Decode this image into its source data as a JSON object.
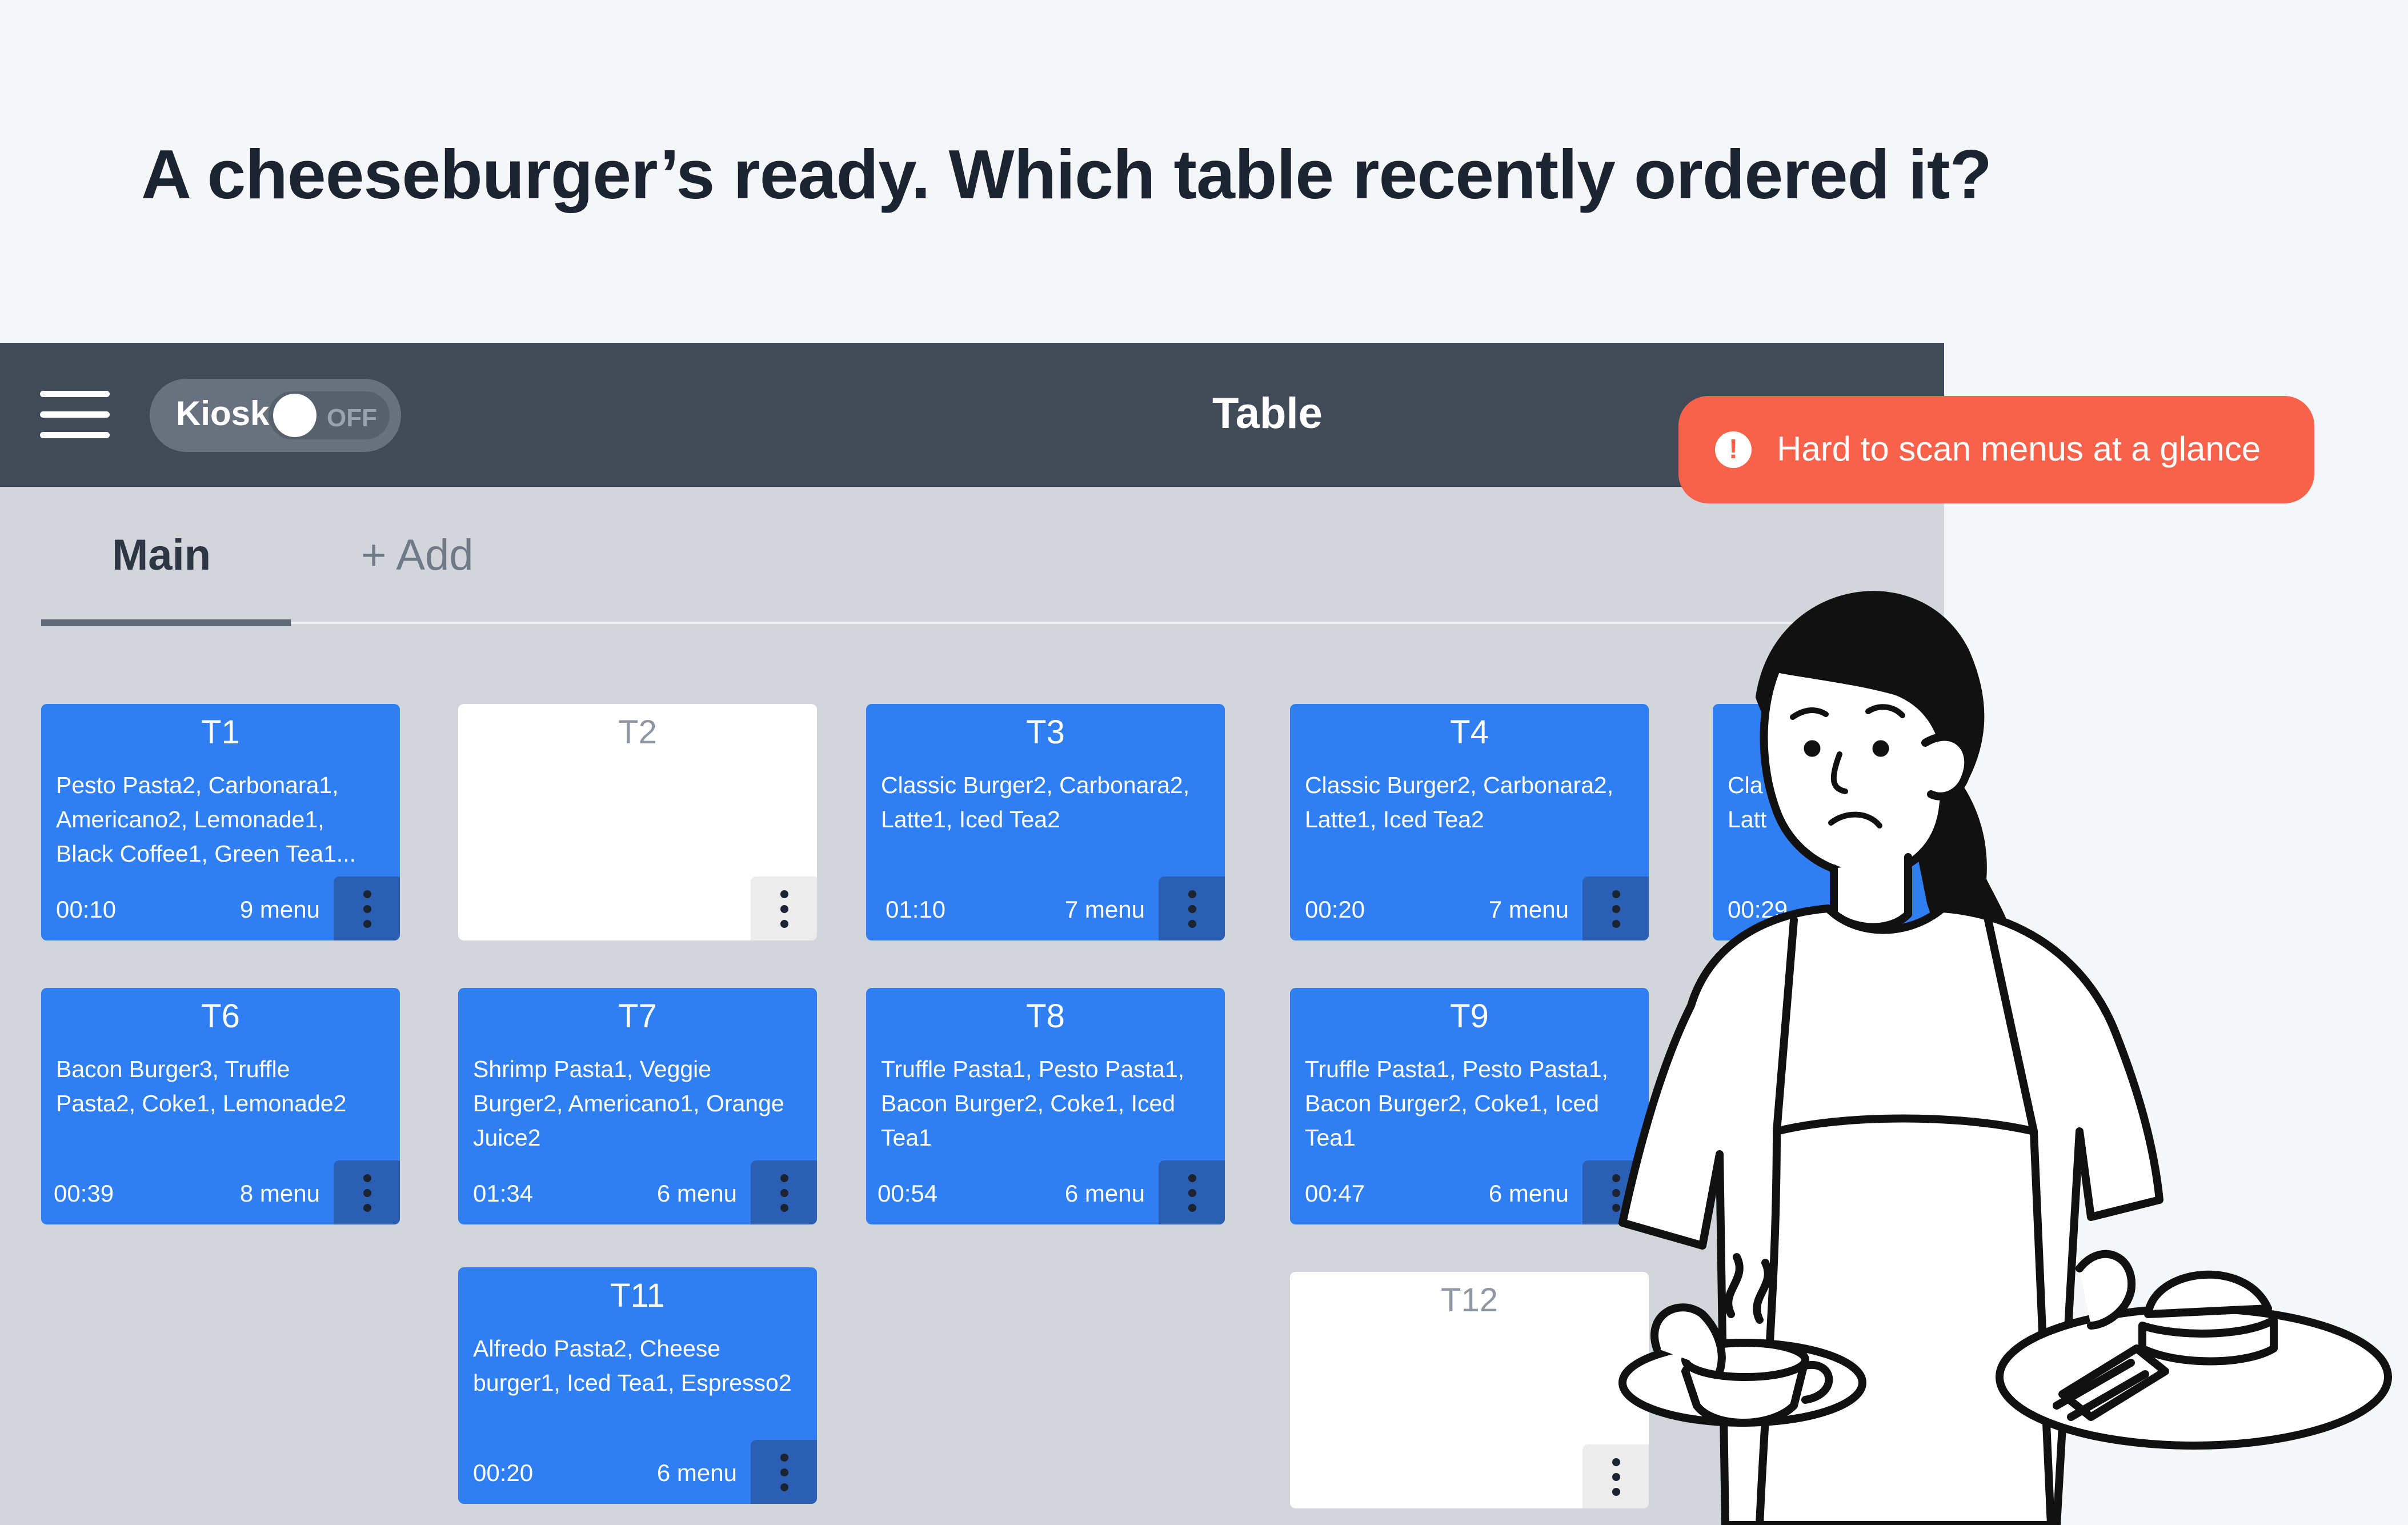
{
  "headline": "A cheeseburger’s ready. Which table recently ordered it?",
  "topbar": {
    "title": "Table",
    "kiosk": {
      "label": "Kiosk",
      "state": "OFF"
    },
    "menu_icon": "hamburger-icon"
  },
  "tabs": {
    "main": "Main",
    "add": "+ Add"
  },
  "tables": [
    {
      "name": "T1",
      "items": "Pesto Pasta2, Carbonara1,\nAmericano2, Lemonade1,\nBlack Coffee1, Green Tea1...",
      "time": "00:10",
      "count": "9 menu"
    },
    {
      "name": "T2",
      "items": "",
      "time": "",
      "count": ""
    },
    {
      "name": "T3",
      "items": "Classic Burger2, Carbonara2,\nLatte1, Iced Tea2",
      "time": "01:10",
      "count": "7 menu"
    },
    {
      "name": "T4",
      "items": "Classic Burger2, Carbonara2,\nLatte1, Iced Tea2",
      "time": "00:20",
      "count": "7 menu"
    },
    {
      "name": "",
      "items": "Cla\nLatt",
      "time": "00:29",
      "count": ""
    },
    {
      "name": "T6",
      "items": "Bacon Burger3, Truffle\nPasta2, Coke1, Lemonade2",
      "time": "00:39",
      "count": "8 menu"
    },
    {
      "name": "T7",
      "items": "Shrimp Pasta1, Veggie\nBurger2, Americano1, Orange\nJuice2",
      "time": "01:34",
      "count": "6 menu"
    },
    {
      "name": "T8",
      "items": "Truffle Pasta1, Pesto Pasta1,\nBacon Burger2, Coke1, Iced\nTea1",
      "time": "00:54",
      "count": "6 menu"
    },
    {
      "name": "T9",
      "items": "Truffle Pasta1, Pesto Pasta1,\nBacon Burger2, Coke1, Iced\nTea1",
      "time": "00:47",
      "count": "6 menu"
    },
    {
      "name": "T11",
      "items": "Alfredo Pasta2, Cheese\nburger1, Iced Tea1, Espresso2",
      "time": "00:20",
      "count": "6 menu"
    },
    {
      "name": "T12",
      "items": "",
      "time": "",
      "count": ""
    }
  ],
  "toast": {
    "text": "Hard to scan menus at a glance",
    "icon": "alert-icon",
    "color": "#f8624a"
  },
  "colors": {
    "occupied": "#2f7ef2",
    "topbar": "#404b57",
    "background": "#d2d6db"
  }
}
